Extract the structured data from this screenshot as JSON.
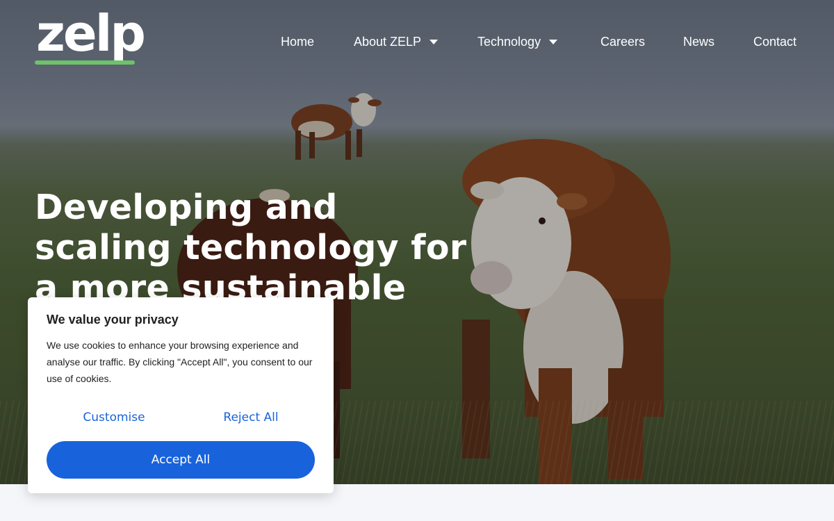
{
  "brand": {
    "logo_text": "zelp",
    "accent": "#6cc36b"
  },
  "nav": {
    "items": [
      {
        "label": "Home",
        "has_dropdown": false
      },
      {
        "label": "About ZELP",
        "has_dropdown": true
      },
      {
        "label": "Technology",
        "has_dropdown": true
      },
      {
        "label": "Careers",
        "has_dropdown": false
      },
      {
        "label": "News",
        "has_dropdown": false
      },
      {
        "label": "Contact",
        "has_dropdown": false
      }
    ]
  },
  "hero": {
    "headline": "Developing and scaling technology for a more sustainable future",
    "image_icon": "cows-in-field-photo"
  },
  "cookie": {
    "title": "We value your privacy",
    "body": "We use cookies to enhance your browsing experience and analyse our traffic. By clicking \"Accept All\", you consent to our use of cookies.",
    "customise_label": "Customise",
    "reject_label": "Reject All",
    "accept_label": "Accept All",
    "primary_color": "#1863dc"
  }
}
